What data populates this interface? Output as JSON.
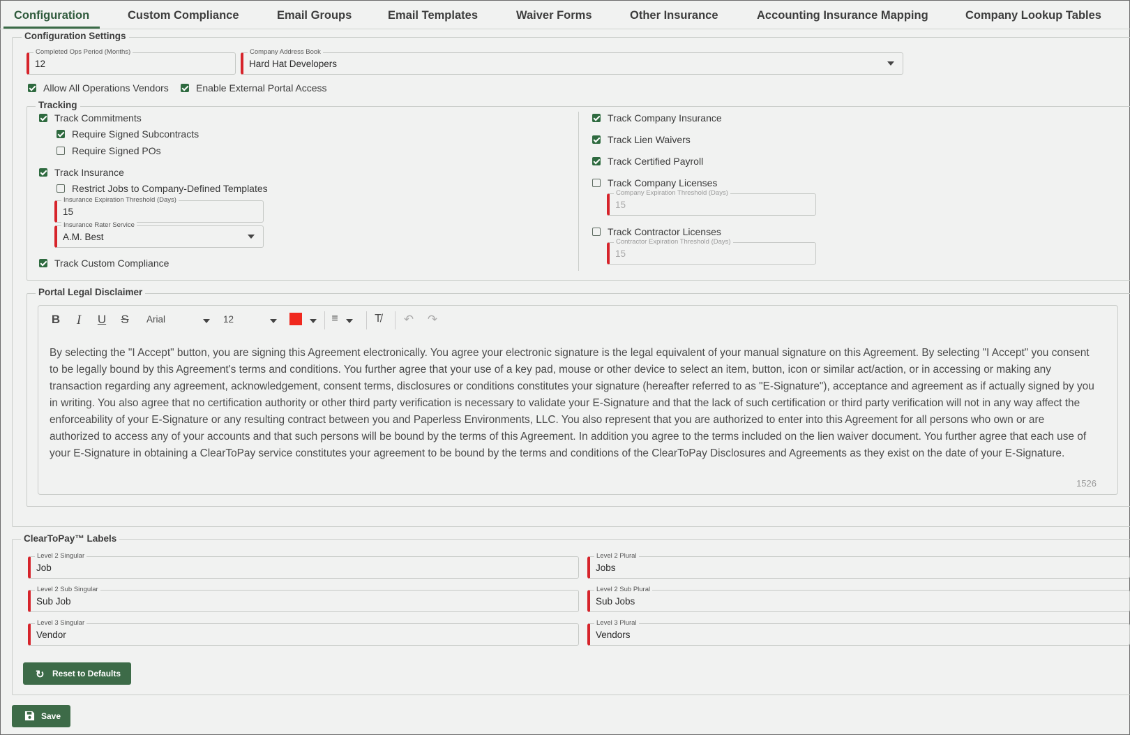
{
  "tabs": [
    {
      "label": "Configuration"
    },
    {
      "label": "Custom Compliance"
    },
    {
      "label": "Email Groups"
    },
    {
      "label": "Email Templates"
    },
    {
      "label": "Waiver Forms"
    },
    {
      "label": "Other Insurance"
    },
    {
      "label": "Accounting Insurance Mapping"
    },
    {
      "label": "Company Lookup Tables"
    }
  ],
  "config": {
    "legend": "Configuration Settings",
    "completed_ops": {
      "label": "Completed Ops Period (Months)",
      "value": "12"
    },
    "address_book": {
      "label": "Company Address Book",
      "value": "Hard Hat Developers"
    },
    "allow_vendors": "Allow All Operations Vendors",
    "external_portal": "Enable External Portal Access"
  },
  "tracking": {
    "legend": "Tracking",
    "track_commitments": "Track Commitments",
    "require_signed_subcontracts": "Require Signed Subcontracts",
    "require_signed_pos": "Require Signed POs",
    "track_insurance": "Track Insurance",
    "restrict_jobs": "Restrict Jobs to Company-Defined Templates",
    "insurance_threshold": {
      "label": "Insurance Expiration Threshold (Days)",
      "value": "15"
    },
    "rater_service": {
      "label": "Insurance Rater Service",
      "value": "A.M. Best"
    },
    "track_custom_compliance": "Track Custom Compliance",
    "track_company_insurance": "Track Company Insurance",
    "track_lien_waivers": "Track Lien Waivers",
    "track_certified_payroll": "Track Certified Payroll",
    "track_company_licenses": "Track Company Licenses",
    "company_threshold": {
      "label": "Company Expiration Threshold (Days)",
      "value": "15"
    },
    "track_contractor_licenses": "Track Contractor Licenses",
    "contractor_threshold": {
      "label": "Contractor Expiration Threshold (Days)",
      "value": "15"
    }
  },
  "disclaimer": {
    "legend": "Portal Legal Disclaimer",
    "font": "Arial",
    "font_size": "12",
    "color": "#f0281e",
    "text": "By selecting the \"I Accept\" button, you are signing this Agreement electronically. You agree your electronic signature is the legal equivalent of your manual signature on this Agreement. By selecting \"I Accept\" you consent to be legally bound by this Agreement's terms and conditions. You further agree that your use of a key pad, mouse or other device to select an item, button, icon or similar act/action, or in accessing or making any transaction regarding any agreement, acknowledgement, consent terms, disclosures or conditions constitutes your signature (hereafter referred to as \"E-Signature\"), acceptance and agreement as if actually signed by you in writing. You also agree that no certification authority or other third party verification is necessary to validate your E-Signature and that the lack of such certification or third party verification will not in any way affect the enforceability of your E-Signature or any resulting contract between you and Paperless Environments, LLC. You also represent that you are authorized to enter into this Agreement for all persons who own or are authorized to access any of your accounts and that such persons will be bound by the terms of this Agreement. In addition you agree to the terms included on the lien waiver document. You further agree that each use of your E-Signature in obtaining a ClearToPay service constitutes your agreement to be bound by the terms and conditions of the ClearToPay Disclosures and Agreements as they exist on the date of your E-Signature.",
    "char_count": "1526"
  },
  "labels": {
    "legend": "ClearToPay™ Labels",
    "l2_singular": {
      "label": "Level 2 Singular",
      "value": "Job"
    },
    "l2_plural": {
      "label": "Level 2 Plural",
      "value": "Jobs"
    },
    "l2_sub_singular": {
      "label": "Level 2 Sub Singular",
      "value": "Sub Job"
    },
    "l2_sub_plural": {
      "label": "Level 2 Sub Plural",
      "value": "Sub Jobs"
    },
    "l3_singular": {
      "label": "Level 3 Singular",
      "value": "Vendor"
    },
    "l3_plural": {
      "label": "Level 3 Plural",
      "value": "Vendors"
    },
    "reset_button": "Reset to Defaults"
  },
  "save_button": "Save",
  "colors": {
    "accent": "#3d6b48",
    "required": "#d6242b"
  }
}
